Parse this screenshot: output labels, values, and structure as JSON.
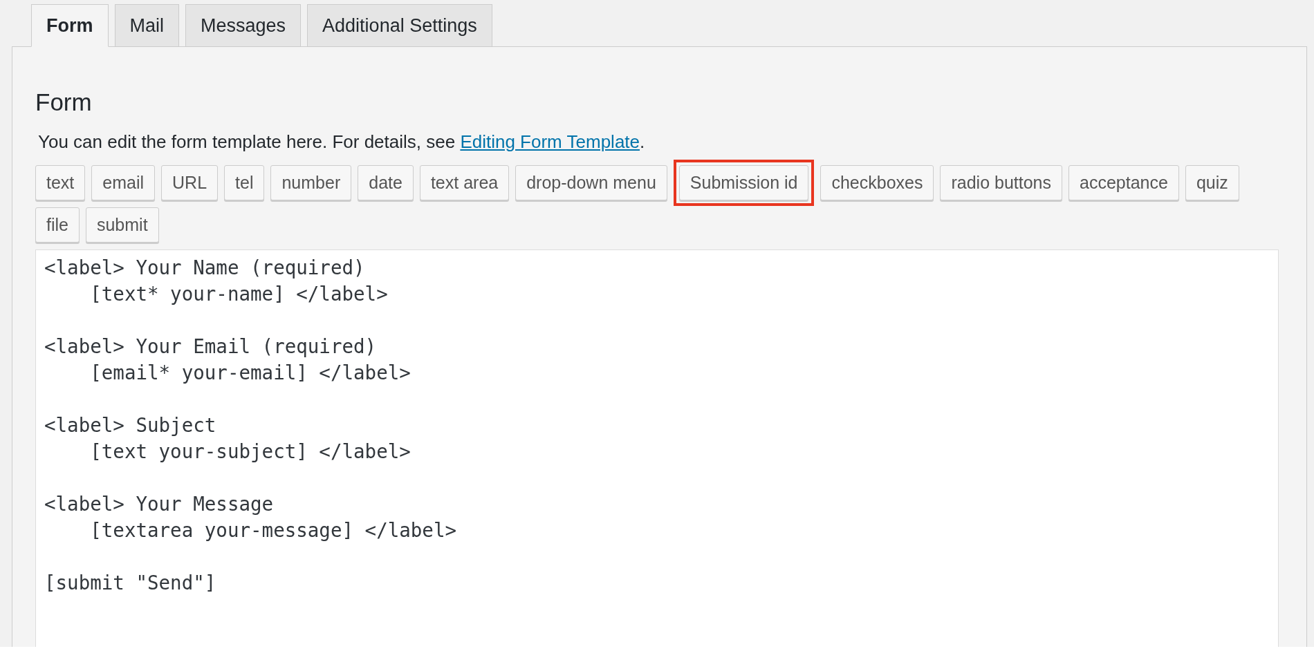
{
  "tabs": [
    {
      "label": "Form",
      "selected": true
    },
    {
      "label": "Mail",
      "selected": false
    },
    {
      "label": "Messages",
      "selected": false
    },
    {
      "label": "Additional Settings",
      "selected": false
    }
  ],
  "panel": {
    "heading": "Form",
    "description": "You can edit the form template here. For details, see ",
    "description_link": "Editing Form Template",
    "description_end": ".",
    "tag_buttons": [
      {
        "label": "text",
        "highlighted": false
      },
      {
        "label": "email",
        "highlighted": false
      },
      {
        "label": "URL",
        "highlighted": false
      },
      {
        "label": "tel",
        "highlighted": false
      },
      {
        "label": "number",
        "highlighted": false
      },
      {
        "label": "date",
        "highlighted": false
      },
      {
        "label": "text area",
        "highlighted": false
      },
      {
        "label": "drop-down menu",
        "highlighted": false
      },
      {
        "label": "Submission id",
        "highlighted": true
      },
      {
        "label": "checkboxes",
        "highlighted": false
      },
      {
        "label": "radio buttons",
        "highlighted": false
      },
      {
        "label": "acceptance",
        "highlighted": false
      },
      {
        "label": "quiz",
        "highlighted": false
      },
      {
        "label": "file",
        "highlighted": false
      },
      {
        "label": "submit",
        "highlighted": false
      }
    ],
    "template": {
      "value": "<label> Your Name (required)\n    [text* your-name] </label>\n\n<label> Your Email (required)\n    [email* your-email] </label>\n\n<label> Subject\n    [text your-subject] </label>\n\n<label> Your Message\n    [textarea your-message] </label>\n\n[submit \"Send\"]"
    }
  }
}
